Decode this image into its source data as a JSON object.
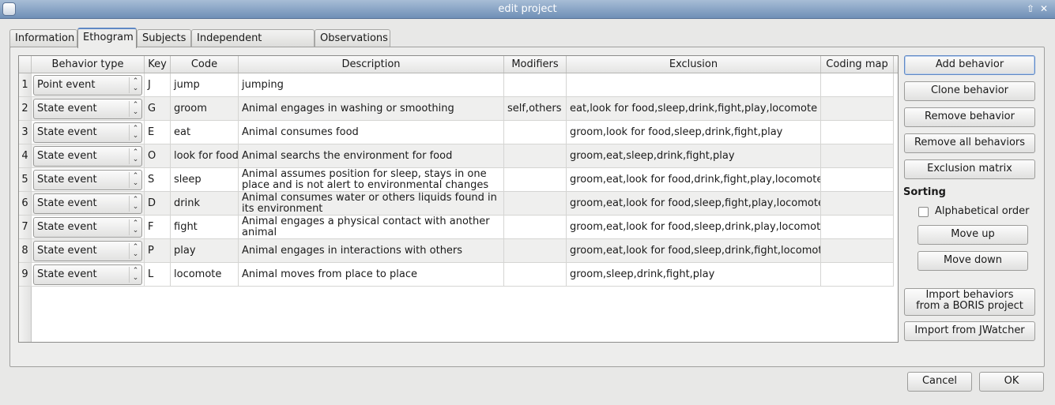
{
  "window": {
    "title": "edit project"
  },
  "tabs": [
    "Information",
    "Ethogram",
    "Subjects",
    "Independent variables",
    "Observations"
  ],
  "table": {
    "headers": [
      "Behavior type",
      "Key",
      "Code",
      "Description",
      "Modifiers",
      "Exclusion",
      "Coding map"
    ],
    "rows": [
      {
        "n": "1",
        "type": "Point event",
        "key": "J",
        "code": "jump",
        "description": "jumping",
        "modifiers": "",
        "exclusion": "",
        "coding_map": ""
      },
      {
        "n": "2",
        "type": "State event",
        "key": "G",
        "code": "groom",
        "description": "Animal engages in washing or smoothing",
        "modifiers": "self,others",
        "exclusion": "eat,look for food,sleep,drink,fight,play,locomote",
        "coding_map": ""
      },
      {
        "n": "3",
        "type": "State event",
        "key": "E",
        "code": "eat",
        "description": "Animal consumes food",
        "modifiers": "",
        "exclusion": "groom,look for food,sleep,drink,fight,play",
        "coding_map": ""
      },
      {
        "n": "4",
        "type": "State event",
        "key": "O",
        "code": "look for food",
        "description": "Animal searchs the environment for food",
        "modifiers": "",
        "exclusion": "groom,eat,sleep,drink,fight,play",
        "coding_map": ""
      },
      {
        "n": "5",
        "type": "State event",
        "key": "S",
        "code": "sleep",
        "description": "Animal assumes position for sleep, stays in one place and is not alert to environmental changes",
        "modifiers": "",
        "exclusion": "groom,eat,look for food,drink,fight,play,locomote",
        "coding_map": ""
      },
      {
        "n": "6",
        "type": "State event",
        "key": "D",
        "code": "drink",
        "description": "Animal consumes water or others liquids found in its environment",
        "modifiers": "",
        "exclusion": "groom,eat,look for food,sleep,fight,play,locomote",
        "coding_map": ""
      },
      {
        "n": "7",
        "type": "State event",
        "key": "F",
        "code": "fight",
        "description": "Animal engages a physical contact with another animal",
        "modifiers": "",
        "exclusion": "groom,eat,look for food,sleep,drink,play,locomote",
        "coding_map": ""
      },
      {
        "n": "8",
        "type": "State event",
        "key": "P",
        "code": "play",
        "description": "Animal engages in interactions with others",
        "modifiers": "",
        "exclusion": "groom,eat,look for food,sleep,drink,fight,locomote",
        "coding_map": ""
      },
      {
        "n": "9",
        "type": "State event",
        "key": "L",
        "code": "locomote",
        "description": "Animal moves from place to place",
        "modifiers": "",
        "exclusion": "groom,sleep,drink,fight,play",
        "coding_map": ""
      }
    ]
  },
  "side": {
    "add": "Add behavior",
    "clone": "Clone behavior",
    "remove": "Remove behavior",
    "remove_all": "Remove all behaviors",
    "exclusion": "Exclusion matrix",
    "sorting_title": "Sorting",
    "alpha_label": "Alphabetical order",
    "alpha_checked": false,
    "move_up": "Move up",
    "move_down": "Move down",
    "import_boris_1": "Import behaviors",
    "import_boris_2": "from a BORIS project",
    "import_jwatcher": "Import from JWatcher"
  },
  "footer": {
    "cancel": "Cancel",
    "ok": "OK"
  }
}
